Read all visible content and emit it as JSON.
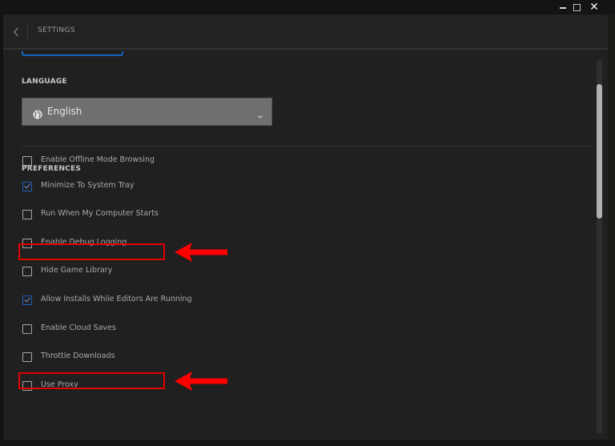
{
  "window": {
    "controls": {
      "minimize": "minimize",
      "maximize": "maximize",
      "close": "✕"
    }
  },
  "header": {
    "back_icon": "chevron-left",
    "title": "SETTINGS"
  },
  "language": {
    "label": "LANGUAGE",
    "selected": "English",
    "icon": "globe",
    "dropdown_icon": "chevron-down"
  },
  "preferences": {
    "label": "PREFERENCES",
    "items": [
      {
        "label": "Enable Offline Mode Browsing",
        "checked": false,
        "highlighted": false
      },
      {
        "label": "Minimize To System Tray",
        "checked": true,
        "highlighted": false
      },
      {
        "label": "Run When My Computer Starts",
        "checked": false,
        "highlighted": true
      },
      {
        "label": "Enable Debug Logging",
        "checked": false,
        "highlighted": false
      },
      {
        "label": "Hide Game Library",
        "checked": false,
        "highlighted": false
      },
      {
        "label": "Allow Installs While Editors Are Running",
        "checked": true,
        "highlighted": false
      },
      {
        "label": "Enable Cloud Saves",
        "checked": false,
        "highlighted": true
      },
      {
        "label": "Throttle Downloads",
        "checked": false,
        "highlighted": false
      },
      {
        "label": "Use Proxy",
        "checked": false,
        "highlighted": false
      }
    ]
  },
  "annotations": {
    "highlight_color": "#e00000",
    "arrow_color": "#ff0000"
  },
  "colors": {
    "accent": "#1565c0",
    "background": "#202020",
    "select_bg": "#6f706e"
  }
}
